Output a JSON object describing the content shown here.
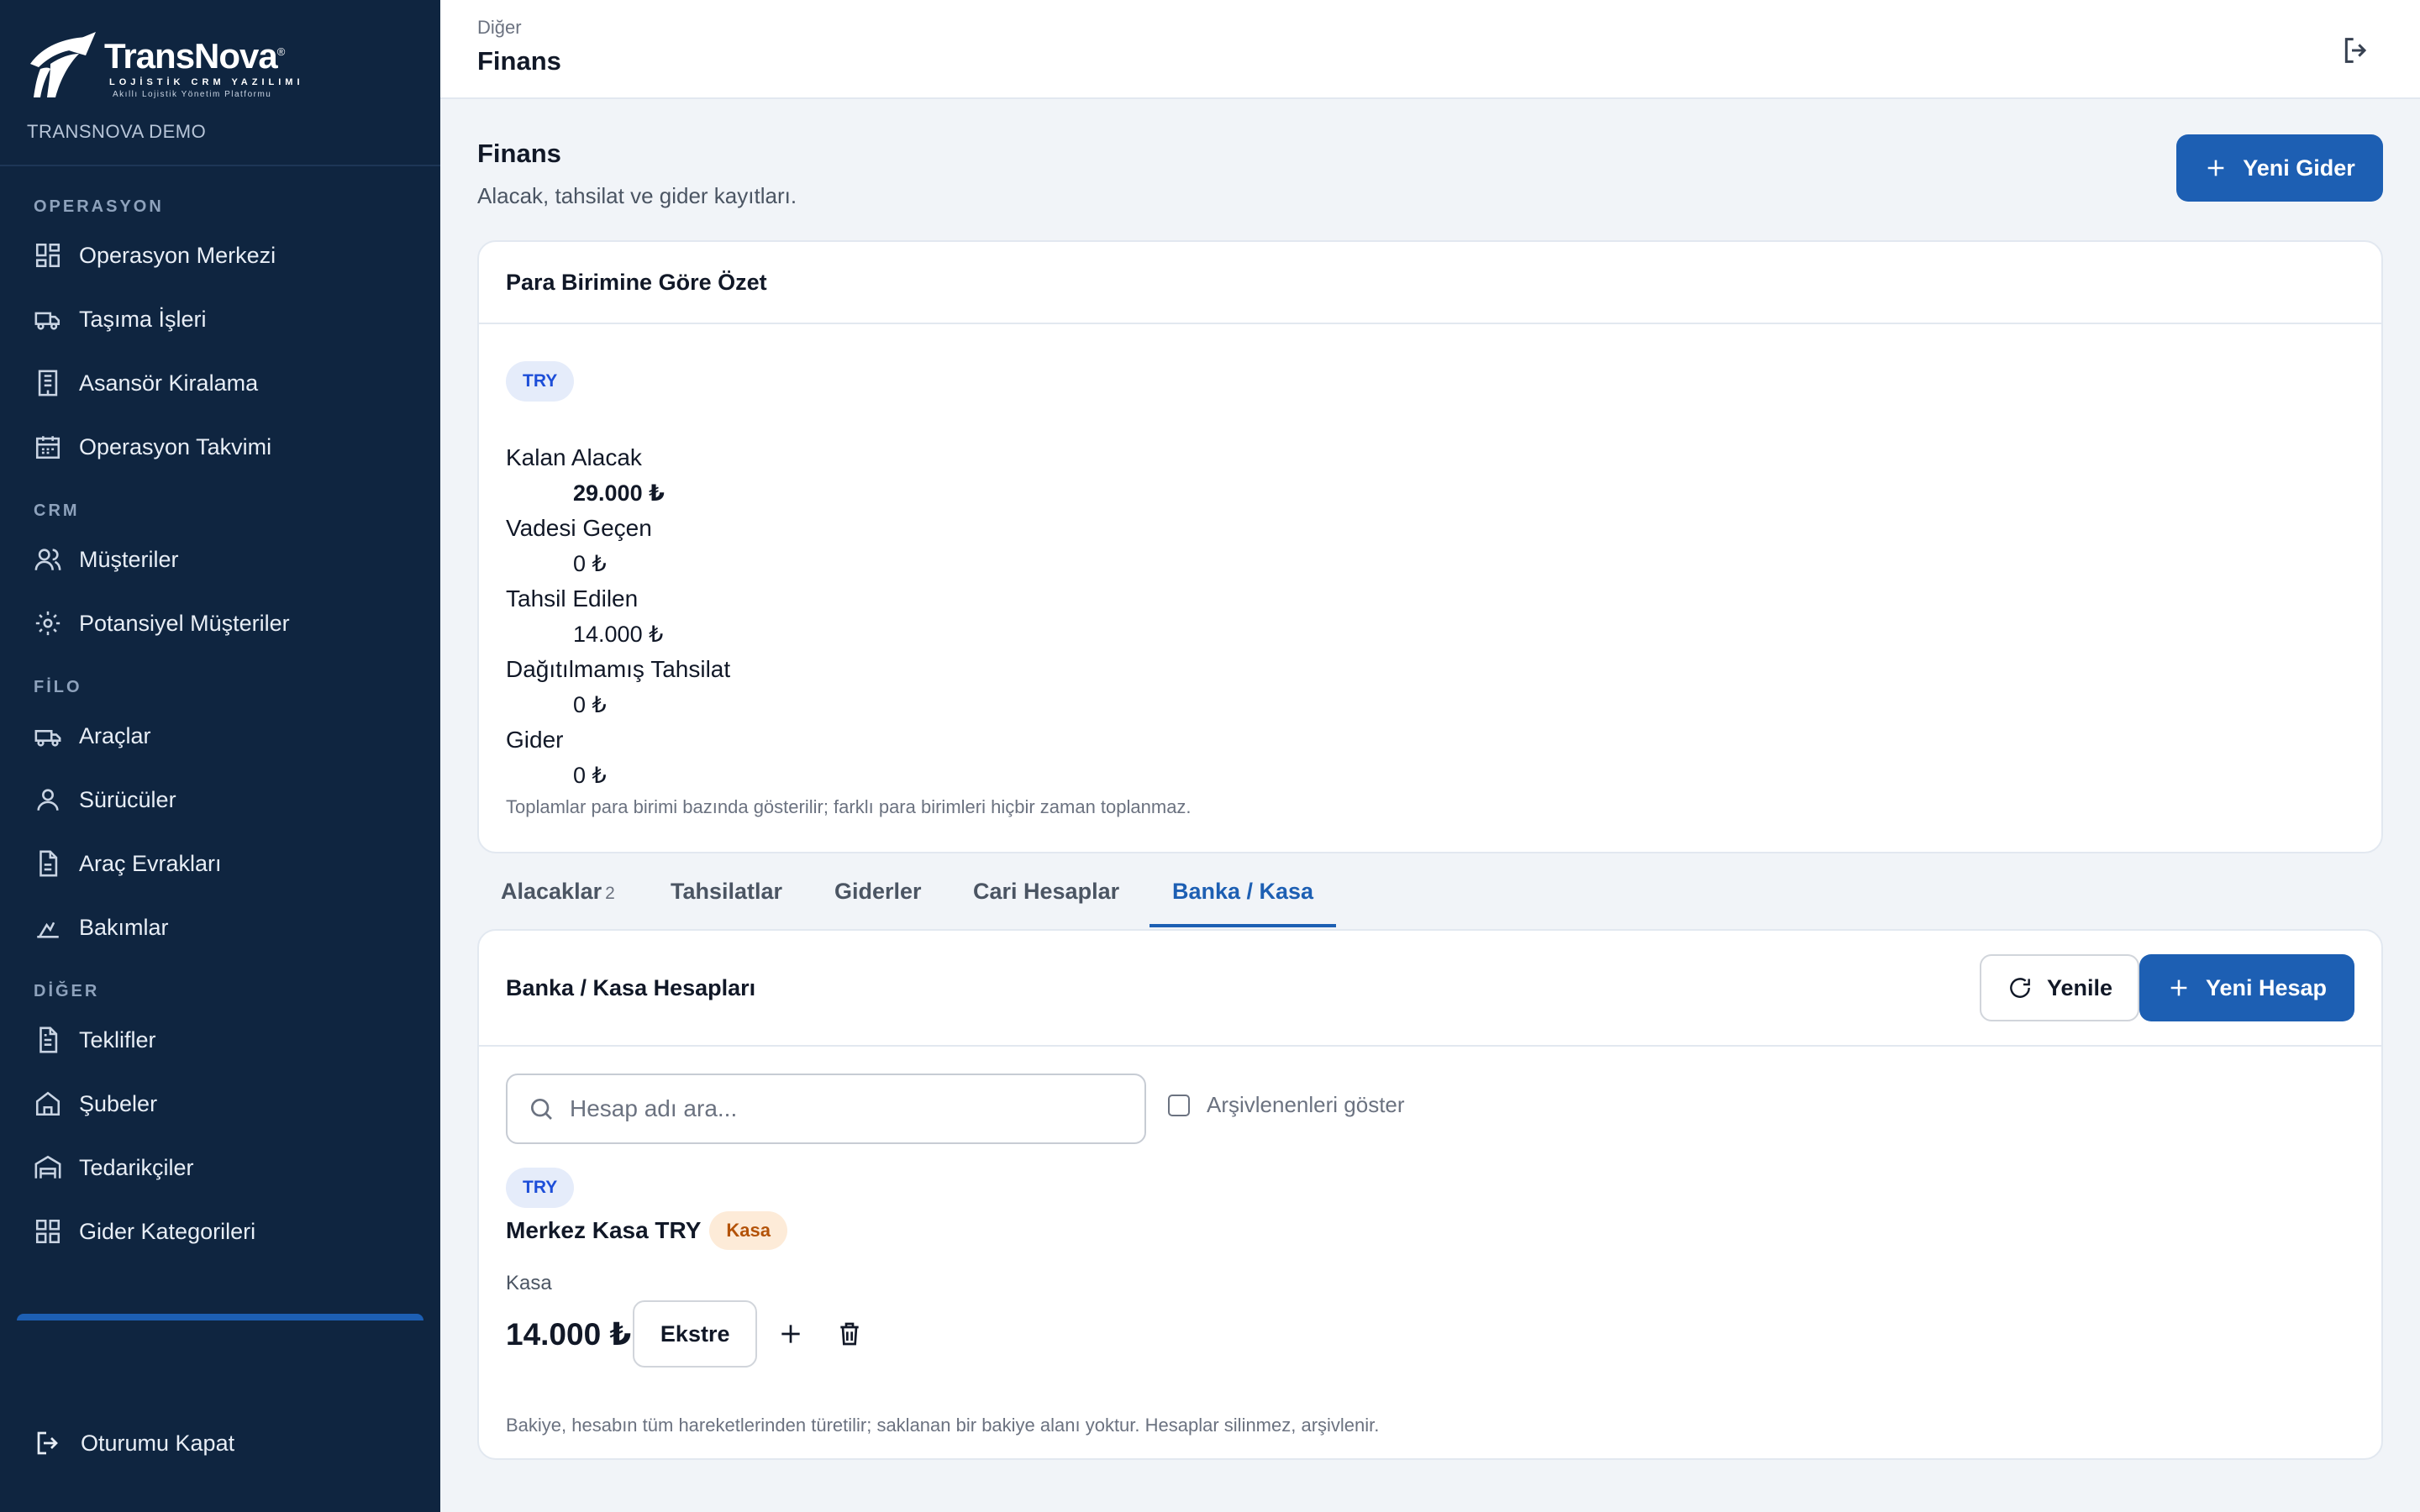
{
  "brand": {
    "name": "TransNova",
    "sub1": "LOJİSTİK CRM YAZILIMI",
    "sub2": "Akıllı Lojistik Yönetim Platformu",
    "tenant": "TRANSNOVA DEMO"
  },
  "sidebar": {
    "sections": [
      {
        "title": "OPERASYON",
        "items": [
          {
            "label": "Operasyon Merkezi",
            "icon": "dashboard-icon"
          },
          {
            "label": "Taşıma İşleri",
            "icon": "truck-icon"
          },
          {
            "label": "Asansör Kiralama",
            "icon": "elevator-icon"
          },
          {
            "label": "Operasyon Takvimi",
            "icon": "calendar-icon"
          }
        ]
      },
      {
        "title": "CRM",
        "items": [
          {
            "label": "Müşteriler",
            "icon": "users-icon"
          },
          {
            "label": "Potansiyel Müşteriler",
            "icon": "sun-icon"
          }
        ]
      },
      {
        "title": "FİLO",
        "items": [
          {
            "label": "Araçlar",
            "icon": "vehicle-icon"
          },
          {
            "label": "Sürücüler",
            "icon": "user-icon"
          },
          {
            "label": "Araç Evrakları",
            "icon": "document-icon"
          },
          {
            "label": "Bakımlar",
            "icon": "maintenance-icon"
          }
        ]
      },
      {
        "title": "DİĞER",
        "items": [
          {
            "label": "Teklifler",
            "icon": "file-text-icon"
          },
          {
            "label": "Şubeler",
            "icon": "building-icon"
          },
          {
            "label": "Tedarikçiler",
            "icon": "warehouse-icon"
          },
          {
            "label": "Gider Kategorileri",
            "icon": "grid-icon"
          }
        ]
      }
    ],
    "logout_label": "Oturumu Kapat"
  },
  "topbar": {
    "breadcrumb": "Diğer",
    "title": "Finans"
  },
  "page": {
    "title": "Finans",
    "subtitle": "Alacak, tahsilat ve gider kayıtları.",
    "new_expense_label": "Yeni Gider"
  },
  "summary": {
    "title": "Para Birimine Göre Özet",
    "currency": "TRY",
    "metrics": [
      {
        "label": "Kalan Alacak",
        "value": "29.000 ₺"
      },
      {
        "label": "Vadesi Geçen",
        "value": "0 ₺"
      },
      {
        "label": "Tahsil Edilen",
        "value": "14.000 ₺"
      },
      {
        "label": "Dağıtılmamış Tahsilat",
        "value": "0 ₺"
      },
      {
        "label": "Gider",
        "value": "0 ₺"
      }
    ],
    "note": "Toplamlar para birimi bazında gösterilir; farklı para birimleri hiçbir zaman toplanmaz."
  },
  "tabs": [
    {
      "label": "Alacaklar",
      "count": "2"
    },
    {
      "label": "Tahsilatlar",
      "count": ""
    },
    {
      "label": "Giderler",
      "count": ""
    },
    {
      "label": "Cari Hesaplar",
      "count": ""
    },
    {
      "label": "Banka / Kasa",
      "count": ""
    }
  ],
  "active_tab": "Banka / Kasa",
  "accounts": {
    "title": "Banka / Kasa Hesapları",
    "refresh_label": "Yenile",
    "new_account_label": "Yeni Hesap",
    "search_placeholder": "Hesap adı ara...",
    "archive_label": "Arşivlenenleri göster",
    "archive_checked": false,
    "items": [
      {
        "currency": "TRY",
        "name": "Merkez Kasa TRY",
        "type_badge": "Kasa",
        "type": "Kasa",
        "balance": "14.000 ₺",
        "statement_label": "Ekstre"
      }
    ],
    "note": "Bakiye, hesabın tüm hareketlerinden türetilir; saklanan bir bakiye alanı yoktur. Hesaplar silinmez, arşivlenir."
  },
  "colors": {
    "sidebar_bg": "#0f2540",
    "accent": "#1d5fb3",
    "currency_badge_bg": "#e5ecfa",
    "kasa_badge_bg": "#fdebd8",
    "kasa_badge_text": "#b45309"
  }
}
